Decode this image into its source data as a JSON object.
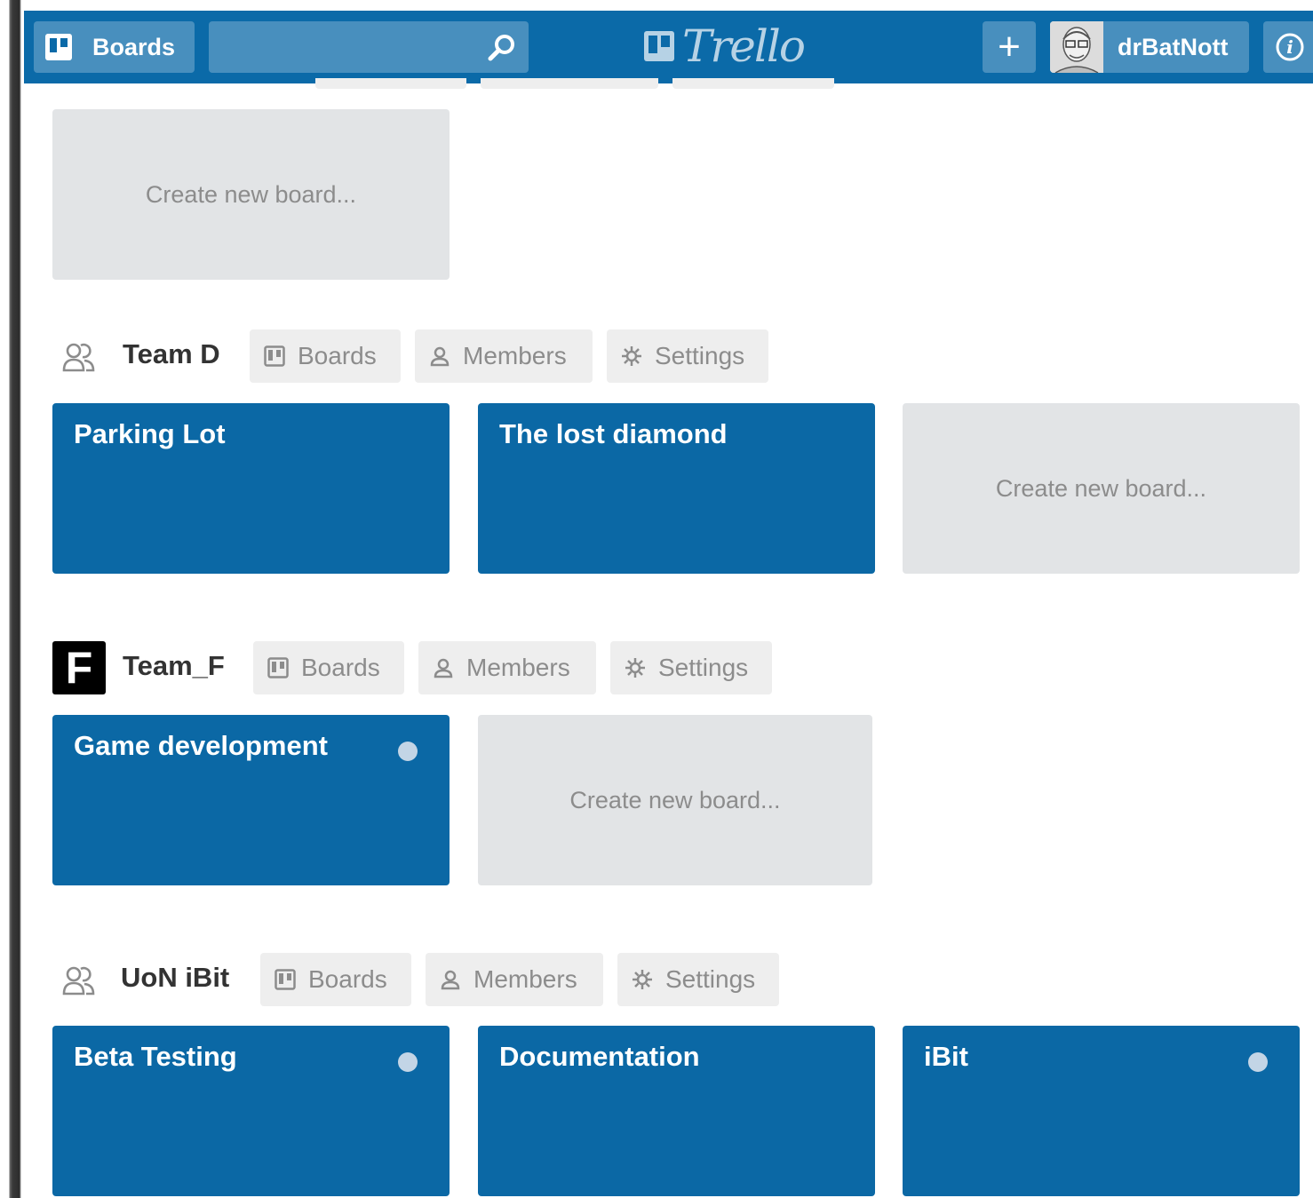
{
  "header": {
    "boards_label": "Boards",
    "search_value": "",
    "logo_text": "Trello",
    "add_label": "+",
    "username": "drBatNott",
    "info_label": "i"
  },
  "create_label": "Create new board...",
  "teams": [
    {
      "name": "Team D",
      "tabs": {
        "boards": "Boards",
        "members": "Members",
        "settings": "Settings"
      },
      "boards": [
        {
          "title": "Parking Lot",
          "starred": false
        },
        {
          "title": "The lost diamond",
          "starred": false
        }
      ]
    },
    {
      "name": "Team_F",
      "badge_letter": "F",
      "tabs": {
        "boards": "Boards",
        "members": "Members",
        "settings": "Settings"
      },
      "boards": [
        {
          "title": "Game development",
          "starred": true
        }
      ]
    },
    {
      "name": "UoN iBit",
      "tabs": {
        "boards": "Boards",
        "members": "Members",
        "settings": "Settings"
      },
      "boards": [
        {
          "title": "Beta Testing",
          "starred": true
        },
        {
          "title": "Documentation",
          "starred": false
        },
        {
          "title": "iBit",
          "starred": true
        }
      ]
    }
  ],
  "colors": {
    "header": "#0b6aa8",
    "board": "#0b68a5",
    "create_tile": "#e2e4e6",
    "tab": "#eeeeee"
  }
}
